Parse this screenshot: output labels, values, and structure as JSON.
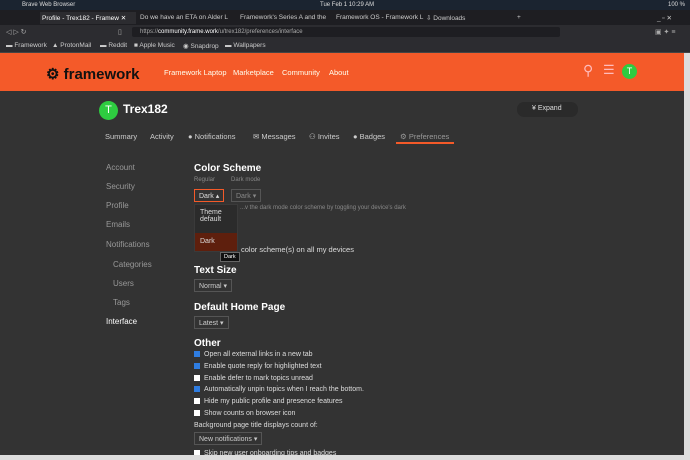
{
  "os": {
    "app": "Brave Web Browser",
    "clock": "Tue Feb 1  10:29 AM",
    "battery": "100 %"
  },
  "browser": {
    "tabs": [
      {
        "label": "Profile - Trex182 - Framew",
        "active": true
      },
      {
        "label": "Do we have an ETA on Alder L"
      },
      {
        "label": "Framework's Series A and the"
      },
      {
        "label": "Framework OS - Framework L"
      },
      {
        "label": "Downloads"
      }
    ],
    "url_prefix": "https://",
    "url_host": "community.frame.work",
    "url_path": "/u/trex182/preferences/interface",
    "bookmarks": [
      "Framework",
      "ProtonMail",
      "Reddit",
      "Apple Music",
      "Snapdrop",
      "Wallpapers"
    ]
  },
  "site": {
    "logo": "framework",
    "nav": [
      "Framework Laptop",
      "Marketplace",
      "Community",
      "About"
    ],
    "avatar_letter": "T",
    "accent": "#f45a29"
  },
  "profile": {
    "username": "Trex182",
    "avatar_letter": "T",
    "expand_label": "Expand",
    "tabs": [
      "Summary",
      "Activity",
      "Notifications",
      "Messages",
      "Invites",
      "Badges",
      "Preferences"
    ]
  },
  "sidebar": [
    "Account",
    "Security",
    "Profile",
    "Emails",
    "Notifications",
    "Categories",
    "Users",
    "Tags",
    "Interface"
  ],
  "prefs": {
    "color_scheme": {
      "title": "Color Scheme",
      "regular_label": "Regular",
      "dark_label": "Dark mode",
      "regular_value": "Dark",
      "dark_value": "Dark",
      "hint": "...v the dark mode color scheme by toggling your device's dark",
      "options": [
        "Theme default",
        "Dark"
      ],
      "tooltip": "Dark",
      "all_devices": "color scheme(s) on all my devices"
    },
    "text_size": {
      "title": "Text Size",
      "value": "Normal"
    },
    "home_page": {
      "title": "Default Home Page",
      "value": "Latest"
    },
    "other": {
      "title": "Other",
      "checkboxes": [
        {
          "label": "Open all external links in a new tab",
          "checked": true
        },
        {
          "label": "Enable quote reply for highlighted text",
          "checked": true
        },
        {
          "label": "Enable defer to mark topics unread",
          "checked": false
        },
        {
          "label": "Automatically unpin topics when I reach the bottom.",
          "checked": true
        },
        {
          "label": "Hide my public profile and presence features",
          "checked": false
        },
        {
          "label": "Show counts on browser icon",
          "checked": false
        }
      ],
      "bg_title_label": "Background page title displays count of:",
      "bg_title_value": "New notifications",
      "last": "Skip new user onboarding tips and badges"
    }
  }
}
